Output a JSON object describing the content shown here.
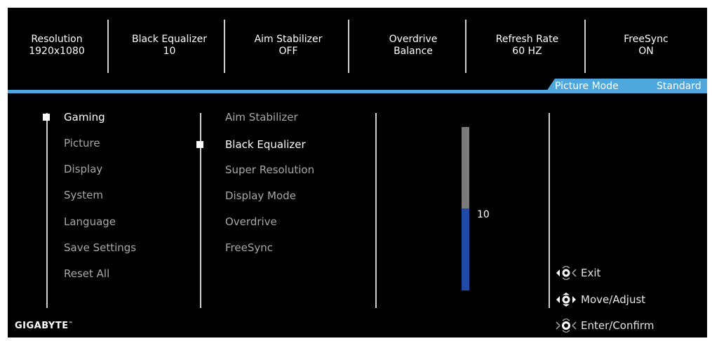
{
  "status": [
    {
      "label": "Resolution",
      "value": "1920x1080"
    },
    {
      "label": "Black Equalizer",
      "value": "10"
    },
    {
      "label": "Aim Stabilizer",
      "value": "OFF"
    },
    {
      "label": "Overdrive",
      "value": "Balance"
    },
    {
      "label": "Refresh Rate",
      "value": "60 HZ"
    },
    {
      "label": "FreeSync",
      "value": "ON"
    }
  ],
  "picture_mode": {
    "label": "Picture Mode",
    "value": "Standard"
  },
  "main_menu": [
    "Gaming",
    "Picture",
    "Display",
    "System",
    "Language",
    "Save Settings",
    "Reset All"
  ],
  "main_menu_selected": "Gaming",
  "sub_menu": [
    "Aim Stabilizer",
    "Black Equalizer",
    "Super Resolution",
    "Display Mode",
    "Overdrive",
    "FreeSync"
  ],
  "sub_menu_selected": "Black Equalizer",
  "slider": {
    "value": "10",
    "fraction": 0.5
  },
  "help": [
    {
      "icon": "joystick-left-icon",
      "label": "Exit"
    },
    {
      "icon": "joystick-all-directions-icon",
      "label": "Move/Adjust"
    },
    {
      "icon": "joystick-press-icon",
      "label": "Enter/Confirm"
    }
  ],
  "brand": {
    "name": "GIGABYTE",
    "mark": "™"
  },
  "colors": {
    "accent": "#4ea7dc",
    "slider_fill": "#1f4aa8",
    "slider_track": "#7a7a7a",
    "background": "#000000"
  }
}
